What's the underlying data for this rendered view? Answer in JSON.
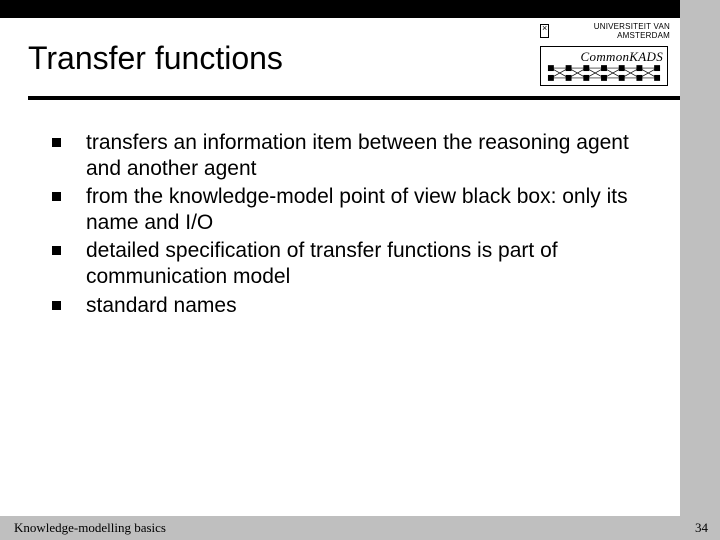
{
  "header": {
    "title": "Transfer functions",
    "university_label": "UNIVERSITEIT VAN AMSTERDAM",
    "commonkads_label": "CommonKADS"
  },
  "bullets": [
    "transfers an information item between the reasoning agent and another agent",
    "from the knowledge-model point of view black box: only its name and I/O",
    "detailed specification of transfer functions is part of communication model",
    "standard names"
  ],
  "footer": {
    "text": "Knowledge-modelling basics",
    "page": "34"
  }
}
